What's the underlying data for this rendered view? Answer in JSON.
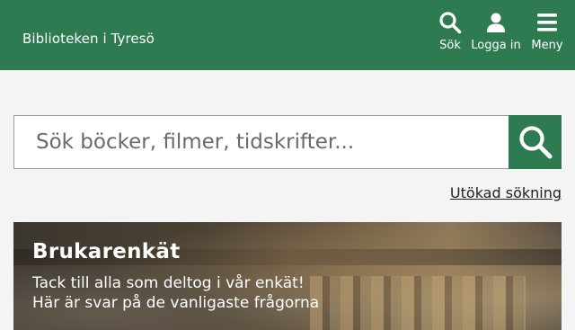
{
  "header": {
    "site_title": "Biblioteken i Tyresö",
    "nav": {
      "search_label": "Sök",
      "login_label": "Logga in",
      "menu_label": "Meny"
    }
  },
  "search": {
    "placeholder": "Sök böcker, filmer, tidskrifter...",
    "advanced_label": "Utökad sökning"
  },
  "banner": {
    "title": "Brukarenkät",
    "line1": "Tack till alla som deltog i vår enkät!",
    "line2": "Här är svar på de vanligaste frågorna"
  },
  "colors": {
    "brand_green": "#2e7b52"
  },
  "icons": {
    "search": "search-icon",
    "login": "user-icon",
    "menu": "hamburger-icon"
  }
}
